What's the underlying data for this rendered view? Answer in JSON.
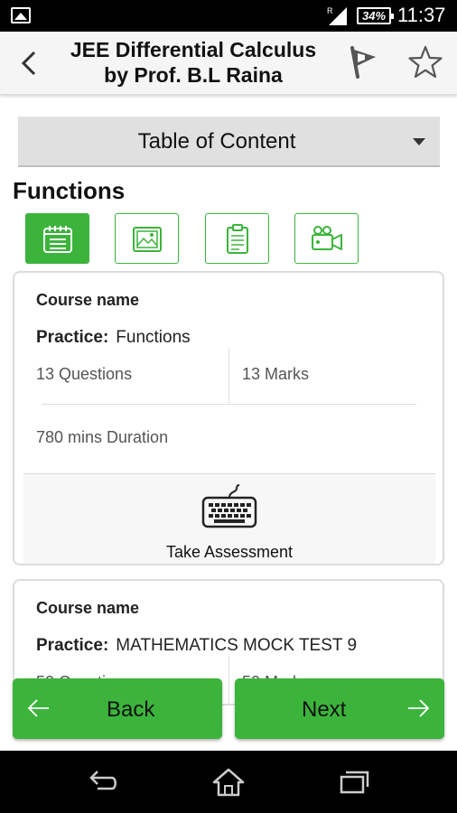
{
  "status_bar": {
    "battery": "34%",
    "time": "11:37",
    "icons": [
      "gallery-icon",
      "signal-icon",
      "battery-icon"
    ]
  },
  "header": {
    "title_line1": "JEE Differential Calculus",
    "title_line2": "by Prof. B.L Raina",
    "icons": [
      "back-arrow-icon",
      "flag-icon",
      "star-icon"
    ]
  },
  "dropdown": {
    "label": "Table of Content"
  },
  "section": {
    "title": "Functions"
  },
  "tabs": [
    {
      "icon": "notepad-icon",
      "active": true
    },
    {
      "icon": "image-icon",
      "active": false
    },
    {
      "icon": "clipboard-icon",
      "active": false
    },
    {
      "icon": "video-camera-icon",
      "active": false
    }
  ],
  "cards": [
    {
      "course_label": "Course name",
      "practice_label": "Practice:",
      "practice_value": "Functions",
      "questions": "13 Questions",
      "marks": "13 Marks",
      "duration": "780 mins Duration",
      "action_label": "Take Assessment"
    },
    {
      "course_label": "Course name",
      "practice_label": "Practice:",
      "practice_value": "MATHEMATICS MOCK TEST 9",
      "questions": "50 Questions",
      "marks": "50 Marks"
    }
  ],
  "actions": {
    "back_label": "Back",
    "next_label": "Next"
  },
  "colors": {
    "accent_green": "#3cb43c",
    "header_bg": "#f5f5f5",
    "dropdown_bg": "#e0e0e0"
  },
  "nav_bar": {
    "icons": [
      "back-nav-icon",
      "home-icon",
      "recent-apps-icon"
    ]
  }
}
